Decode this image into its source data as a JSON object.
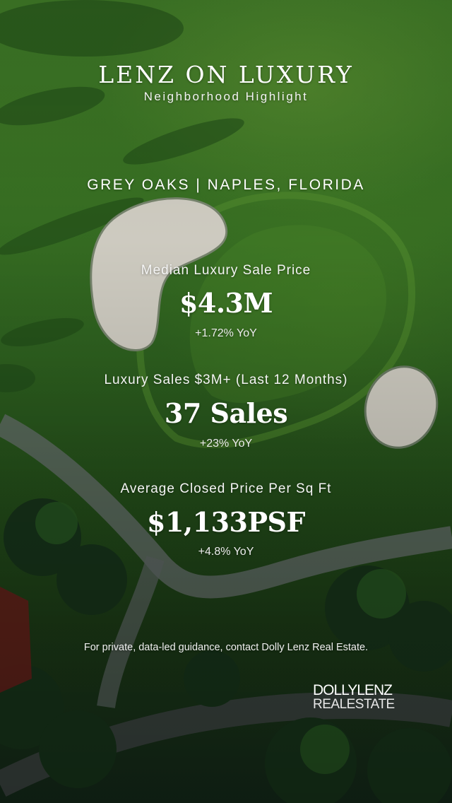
{
  "header": {
    "title": "LENZ ON LUXURY",
    "subtitle": "Neighborhood Highlight"
  },
  "location": "GREY OAKS | NAPLES, FLORIDA",
  "stats": [
    {
      "label": "Median Luxury Sale Price",
      "value": "$4.3M",
      "change": "+1.72% YoY"
    },
    {
      "label": "Luxury Sales $3M+ (Last 12 Months)",
      "value": "37 Sales",
      "change": "+23% YoY"
    },
    {
      "label": "Average Closed Price Per Sq Ft",
      "value": "$1,133PSF",
      "change": "+4.8% YoY"
    }
  ],
  "footer": {
    "contact": "For private, data-led guidance, contact Dolly Lenz Real Estate.",
    "logo_line1": "DOLLYLENZ",
    "logo_line2": "REALESTATE"
  },
  "colors": {
    "text": "#ffffff",
    "grass": "#3a7424",
    "sand": "#d9d6cc"
  }
}
